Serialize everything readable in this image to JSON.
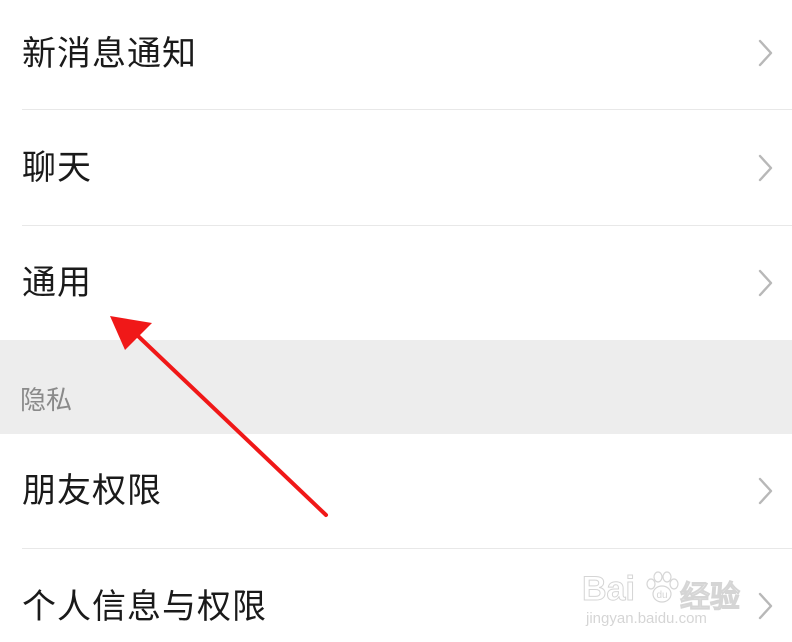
{
  "settings": {
    "items_top": [
      {
        "label": "新消息通知",
        "icon": "chevron-right-icon"
      },
      {
        "label": "聊天",
        "icon": "chevron-right-icon"
      },
      {
        "label": "通用",
        "icon": "chevron-right-icon"
      }
    ],
    "privacy_section": {
      "title": "隐私",
      "items": [
        {
          "label": "朋友权限",
          "icon": "chevron-right-icon"
        },
        {
          "label": "个人信息与权限",
          "icon": "chevron-right-icon"
        }
      ]
    }
  },
  "watermark": {
    "brand": "Bai",
    "brand_suffix": "du",
    "product": "经验",
    "url": "jingyan.baidu.com"
  },
  "colors": {
    "background": "#ffffff",
    "section_bg": "#ededed",
    "text_primary": "#1a1a1a",
    "text_secondary": "#8a8a8a",
    "chevron": "#b8b8b8",
    "divider": "#e8e8e8",
    "annotation_arrow": "#f01818"
  }
}
